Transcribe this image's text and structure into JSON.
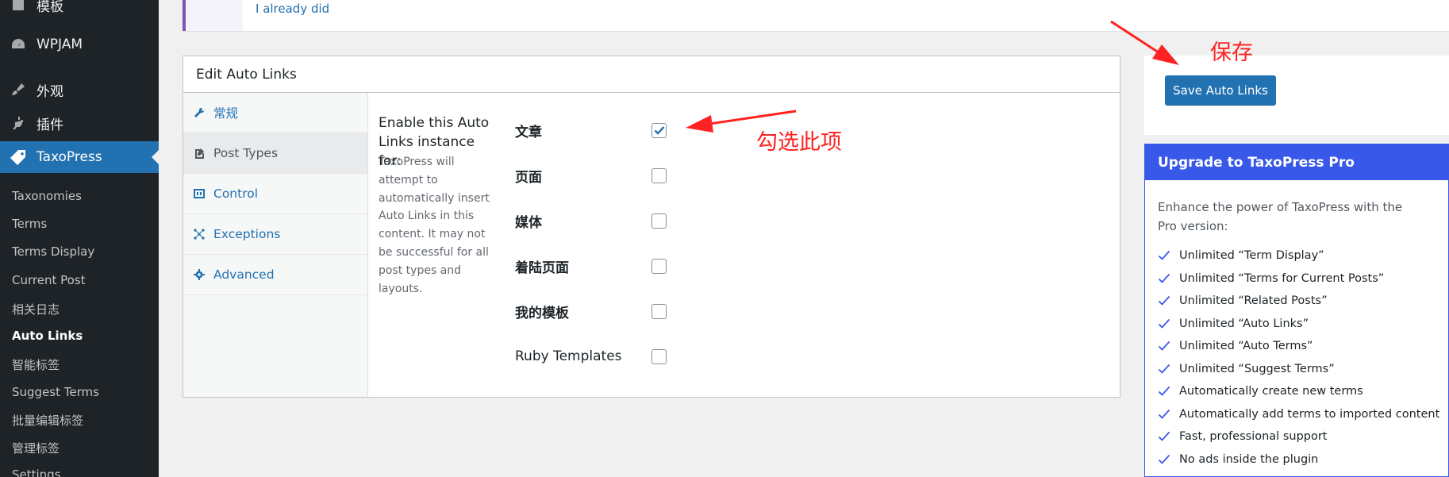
{
  "sidebar": {
    "top_partial": "模板",
    "menu": [
      {
        "label": "WPJAM",
        "icon": "dashboard-icon"
      },
      {
        "label": "外观",
        "icon": "brush-icon"
      },
      {
        "label": "插件",
        "icon": "plugin-icon"
      },
      {
        "label": "TaxoPress",
        "icon": "tag-icon"
      }
    ],
    "submenu": [
      "Taxonomies",
      "Terms",
      "Terms Display",
      "Current Post",
      "相关日志",
      "Auto Links",
      "智能标签",
      "Suggest Terms",
      "批量编辑标签",
      "管理标签",
      "Settings"
    ],
    "active_submenu": "Auto Links"
  },
  "notice": {
    "link": "I already did"
  },
  "panel": {
    "title": "Edit Auto Links",
    "tabs": [
      {
        "label": "常规",
        "icon": "wrench-icon"
      },
      {
        "label": "Post Types",
        "icon": "admin-post-icon"
      },
      {
        "label": "Control",
        "icon": "control-icon"
      },
      {
        "label": "Exceptions",
        "icon": "network-icon"
      },
      {
        "label": "Advanced",
        "icon": "gear-icon"
      }
    ],
    "active_tab": "Post Types",
    "field_title": "Enable this Auto Links instance for:",
    "field_desc": "TaxoPress will attempt to automatically insert Auto Links in this content. It may not be successful for all post types and layouts.",
    "options": [
      {
        "label": "文章",
        "checked": true
      },
      {
        "label": "页面",
        "checked": false
      },
      {
        "label": "媒体",
        "checked": false
      },
      {
        "label": "着陆页面",
        "checked": false
      },
      {
        "label": "我的模板",
        "checked": false
      },
      {
        "label": "Ruby Templates",
        "checked": false
      }
    ]
  },
  "save": {
    "button": "Save Auto Links"
  },
  "pro": {
    "title": "Upgrade to TaxoPress Pro",
    "intro": "Enhance the power of TaxoPress with the Pro version:",
    "features": [
      "Unlimited “Term Display”",
      "Unlimited “Terms for Current Posts”",
      "Unlimited “Related Posts”",
      "Unlimited “Auto Links”",
      "Unlimited “Auto Terms”",
      "Unlimited “Suggest Terms”",
      "Automatically create new terms",
      "Automatically add terms to imported content",
      "Fast, professional support",
      "No ads inside the plugin"
    ]
  },
  "annotations": {
    "save_note": "保存",
    "check_note": "勾选此项",
    "color": "#ff2222"
  }
}
